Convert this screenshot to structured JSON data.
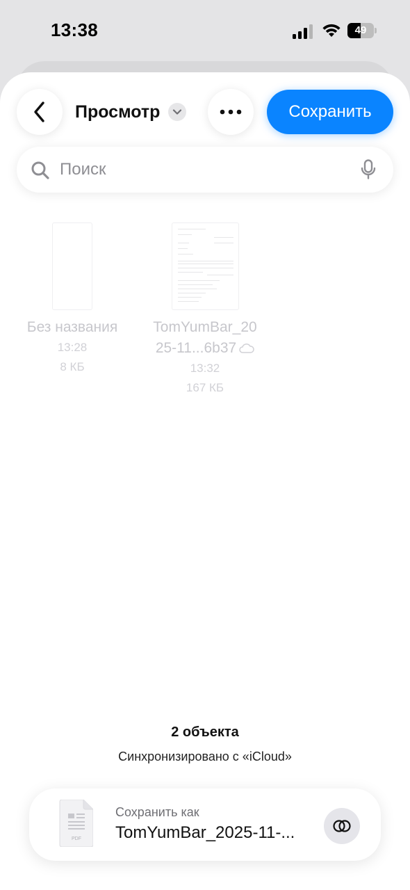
{
  "status_bar": {
    "time": "13:38",
    "battery_text": "49",
    "battery_level_percent": 49
  },
  "toolbar": {
    "title": "Просмотр",
    "save_label": "Сохранить",
    "accent_color": "#0a84ff"
  },
  "search": {
    "placeholder": "Поиск"
  },
  "files": [
    {
      "name": "Без названия",
      "time": "13:28",
      "size": "8 КБ"
    },
    {
      "name_line1": "TomYumBar_20",
      "name_line2": "25-11...6b37",
      "time": "13:32",
      "size": "167 КБ",
      "icon": "cloud-icon"
    }
  ],
  "footer": {
    "count": "2 объекта",
    "sync": "Синхронизировано с «iCloud»"
  },
  "save_as": {
    "label": "Сохранить как",
    "filename": "TomYumBar_2025-11-...",
    "file_icon_text": "PDF"
  }
}
